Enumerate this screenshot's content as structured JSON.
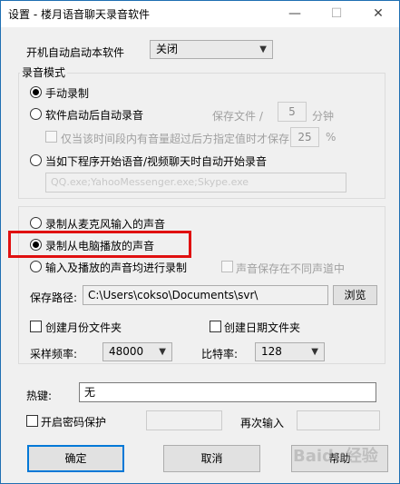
{
  "window": {
    "title": "设置 - 楼月语音聊天录音软件",
    "min_glyph": "—",
    "max_glyph": "☐",
    "close_glyph": "✕"
  },
  "autostart": {
    "label": "开机自动启动本软件",
    "value": "关闭"
  },
  "record_mode": {
    "title": "录音模式",
    "manual": "手动录制",
    "auto_after_start": "软件启动后自动录音",
    "save_file_label": "保存文件 /",
    "save_file_minutes": "5",
    "minutes_unit": "分钟",
    "only_when_volume": "仅当该时间段内有音量超过后方指定值时才保存",
    "volume_threshold": "25",
    "percent": "%",
    "when_programs": "当如下程序开始语音/视频聊天时自动开始录音",
    "programs_list": "QQ.exe;YahooMessenger.exe;Skype.exe"
  },
  "source": {
    "mic": "录制从麦克风输入的声音",
    "speaker": "录制从电脑播放的声音",
    "both": "输入及播放的声音均进行录制",
    "diff_channels": "声音保存在不同声道中"
  },
  "save_path": {
    "label": "保存路径:",
    "value": "C:\\Users\\cokso\\Documents\\svr\\",
    "browse": "浏览"
  },
  "folders": {
    "monthly": "创建月份文件夹",
    "daily": "创建日期文件夹"
  },
  "audio": {
    "sample_rate_label": "采样频率:",
    "sample_rate": "48000",
    "bitrate_label": "比特率:",
    "bitrate": "128"
  },
  "hotkey": {
    "label": "热键:",
    "value": "无"
  },
  "password": {
    "enable": "开启密码保护",
    "reenter": "再次输入"
  },
  "buttons": {
    "ok": "确定",
    "cancel": "取消",
    "help": "帮助"
  },
  "watermark": "Baidu经验",
  "icons": {
    "chevron": "chevron-down-icon"
  },
  "colors": {
    "highlight_border": "#e01010",
    "default_button_border": "#0078d7"
  }
}
